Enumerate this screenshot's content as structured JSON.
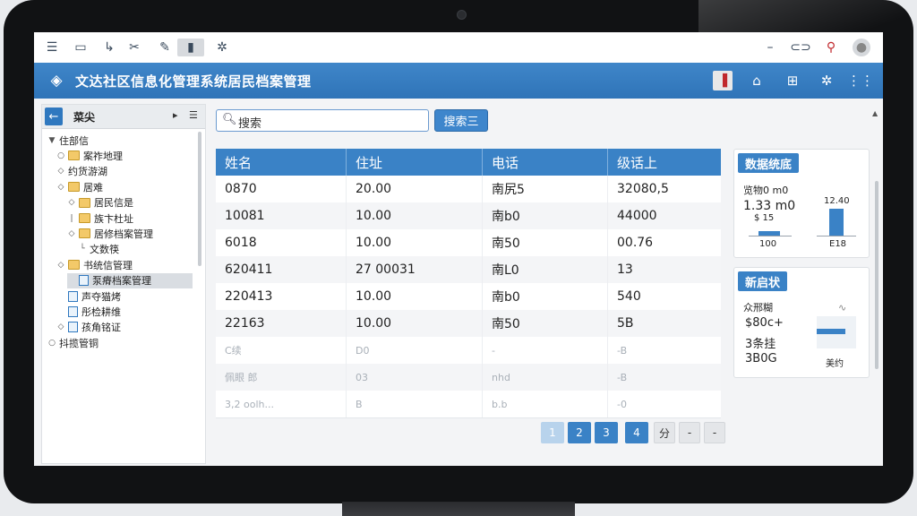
{
  "toolbar": {
    "left_icons": [
      "menu-icon",
      "monitor-icon",
      "tools-icon",
      "scissors-icon",
      "brush-icon",
      "book-icon",
      "gear-icon"
    ],
    "right_icons": [
      "minimize-icon",
      "link-icon",
      "user-pin-icon",
      "avatar-icon"
    ]
  },
  "app": {
    "title": "文达社区信息化管理系统居民档案管理"
  },
  "sidebar": {
    "title": "菜尖",
    "items": [
      {
        "label": "住部信",
        "level": 0,
        "icon": "none",
        "toggle": "▼"
      },
      {
        "label": "案祚地理",
        "level": 1,
        "icon": "folder",
        "toggle": "○"
      },
      {
        "label": "约货游湖",
        "level": 1,
        "icon": "none",
        "toggle": "◇"
      },
      {
        "label": "居难",
        "level": 1,
        "icon": "folder",
        "toggle": "◇"
      },
      {
        "label": "居民信是",
        "level": 2,
        "icon": "folder",
        "toggle": "◇"
      },
      {
        "label": "族卞杜址",
        "level": 2,
        "icon": "folder",
        "toggle": "|"
      },
      {
        "label": "居修档案管理",
        "level": 2,
        "icon": "folder",
        "toggle": "◇"
      },
      {
        "label": "文数筷",
        "level": 3,
        "icon": "none",
        "toggle": "└"
      },
      {
        "label": "书统信管理",
        "level": 1,
        "icon": "folder",
        "toggle": "◇"
      },
      {
        "label": "泵瘠档案管理",
        "level": 0,
        "icon": "doc",
        "toggle": ""
      },
      {
        "label": "声夺猫烤",
        "level": 1,
        "icon": "doc",
        "toggle": ""
      },
      {
        "label": "彤检耕维",
        "level": 1,
        "icon": "doc",
        "toggle": ""
      },
      {
        "label": "孩角铭证",
        "level": 1,
        "icon": "doc",
        "toggle": "◇"
      },
      {
        "label": "抖揽管铜",
        "level": 0,
        "icon": "none",
        "toggle": "○"
      }
    ]
  },
  "search": {
    "placeholder": "搜索",
    "button_label": "搜索三"
  },
  "table": {
    "headers": [
      "姓名",
      "住址",
      "电话",
      "级话上"
    ],
    "rows": [
      [
        "0870",
        "20.00",
        "南尻5",
        "32080,5"
      ],
      [
        "10081",
        "10.00",
        "南b0",
        "44000"
      ],
      [
        "6018",
        "10.00",
        "南50",
        "00.76"
      ],
      [
        "620411",
        "27 00031",
        "南L0",
        "13"
      ],
      [
        "220413",
        "10.00",
        "南b0",
        "540"
      ],
      [
        "22163",
        "10.00",
        "南50",
        "5B"
      ]
    ],
    "faded_rows": [
      [
        "C续",
        "D0",
        "-",
        "-B"
      ],
      [
        "佩眼  郎",
        "03",
        "nhd",
        "-B"
      ],
      [
        "3,2 oolh...",
        "B",
        "b.b",
        "-0"
      ]
    ]
  },
  "pagination": {
    "pages": [
      "1",
      "2",
      "3",
      "4"
    ],
    "active_pages": [
      "2",
      "3",
      "4"
    ],
    "extra": [
      "分",
      "-",
      "-"
    ]
  },
  "stats_panel": {
    "title": "数据统底",
    "label": "览物0 m0",
    "value": "1.33 m0",
    "sub_label": "$ 15",
    "bar_a_label": "100",
    "bar_b_value": "12.40",
    "bar_b_label": "E18",
    "bar_a_value": 15,
    "bar_b_value_num": 100
  },
  "news_panel": {
    "title": "新启状",
    "label": "众邢糊",
    "line1": "$80c+",
    "line2": "3条挂",
    "line3": "3B0G",
    "footer": "美约"
  },
  "colors": {
    "accent": "#3a82c6",
    "title_bar": "#2f74b8",
    "folder": "#f3c969"
  }
}
